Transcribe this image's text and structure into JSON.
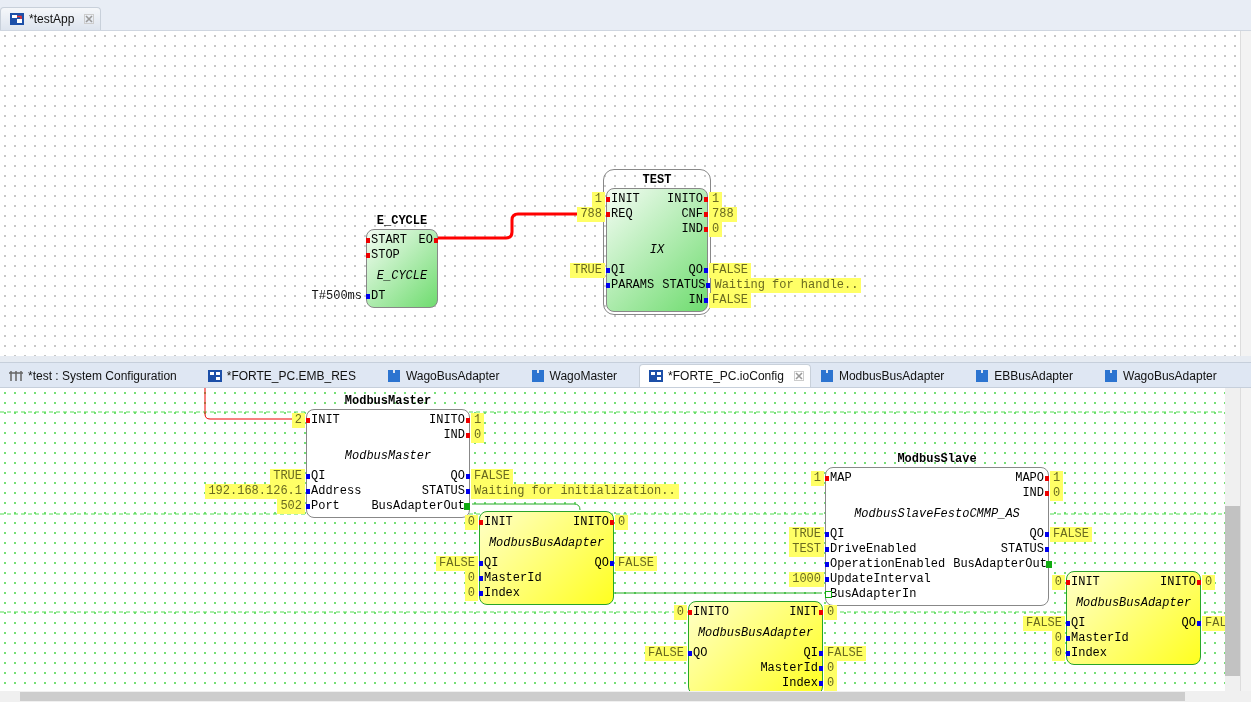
{
  "editor_tabs": [
    {
      "label": "*testApp",
      "kind": "application",
      "selected": true
    }
  ],
  "app_diagram": {
    "blocks": [
      {
        "title": "E_CYCLE",
        "type": "E_CYCLE",
        "kind": "basic",
        "selected": false,
        "events": {
          "left": [
            {
              "name": "START",
              "kind": "event"
            },
            {
              "name": "STOP",
              "kind": "event"
            }
          ],
          "right": [
            {
              "name": "EO",
              "kind": "event"
            }
          ]
        },
        "data": {
          "left": [
            {
              "name": "DT",
              "kind": "data",
              "value": "T#500ms",
              "watched": false
            }
          ]
        }
      },
      {
        "title": "TEST",
        "type": "IX",
        "kind": "basic",
        "selected": true,
        "events": {
          "left": [
            {
              "name": "INIT",
              "kind": "event",
              "value": "1",
              "watched": true
            },
            {
              "name": "REQ",
              "kind": "event",
              "value": "788",
              "watched": true
            }
          ],
          "right": [
            {
              "name": "INITO",
              "kind": "event",
              "value": "1",
              "watched": true
            },
            {
              "name": "CNF",
              "kind": "event",
              "value": "788",
              "watched": true
            },
            {
              "name": "IND",
              "kind": "event",
              "value": "0",
              "watched": true
            }
          ]
        },
        "data": {
          "left": [
            {
              "name": "QI",
              "kind": "data",
              "value": "TRUE",
              "watched": true
            },
            {
              "name": "PARAMS",
              "kind": "data"
            }
          ],
          "right": [
            {
              "name": "QO",
              "kind": "data",
              "value": "FALSE",
              "watched": true
            },
            {
              "name": "STATUS",
              "kind": "data",
              "value": "Waiting for handle..",
              "watched": true
            },
            {
              "name": "IN",
              "kind": "data",
              "value": "FALSE",
              "watched": true
            }
          ]
        }
      }
    ]
  },
  "config_tabs": [
    {
      "label": "*test : System Configuration",
      "kind": "system",
      "selected": false
    },
    {
      "label": "*FORTE_PC.EMB_RES",
      "kind": "resource",
      "selected": false
    },
    {
      "label": "WagoBusAdapter",
      "kind": "adapter",
      "selected": false
    },
    {
      "label": "WagoMaster",
      "kind": "adapter",
      "selected": false
    },
    {
      "label": "*FORTE_PC.ioConfig",
      "kind": "resource",
      "selected": true
    },
    {
      "label": "ModbusBusAdapter",
      "kind": "adapter",
      "selected": false
    },
    {
      "label": "EBBusAdapter",
      "kind": "adapter",
      "selected": false
    },
    {
      "label": "WagoBusAdapter",
      "kind": "adapter",
      "selected": false
    }
  ],
  "config_diagram": {
    "blocks": [
      {
        "title": "ModbusMaster",
        "type": "ModbusMaster",
        "kind": "service",
        "selected": false,
        "events": {
          "left": [
            {
              "name": "INIT",
              "kind": "event",
              "value": "2",
              "watched": true
            }
          ],
          "right": [
            {
              "name": "INITO",
              "kind": "event",
              "value": "1",
              "watched": true
            },
            {
              "name": "IND",
              "kind": "event",
              "value": "0",
              "watched": true
            }
          ]
        },
        "data": {
          "left": [
            {
              "name": "QI",
              "kind": "data",
              "value": "TRUE",
              "watched": true
            },
            {
              "name": "Address",
              "kind": "data",
              "value": "192.168.126.1",
              "watched": true
            },
            {
              "name": "Port",
              "kind": "data",
              "value": "502",
              "watched": true
            }
          ],
          "right": [
            {
              "name": "QO",
              "kind": "data",
              "value": "FALSE",
              "watched": true
            },
            {
              "name": "STATUS",
              "kind": "data",
              "value": "Waiting for initialization..",
              "watched": true
            },
            {
              "name": "BusAdapterOut",
              "kind": "plug"
            }
          ]
        }
      },
      {
        "type": "ModbusBusAdapter",
        "kind": "adapter",
        "selected": false,
        "events": {
          "left": [
            {
              "name": "INIT",
              "kind": "event",
              "value": "0",
              "watched": true
            }
          ],
          "right": [
            {
              "name": "INITO",
              "kind": "event",
              "value": "0",
              "watched": true
            }
          ]
        },
        "data": {
          "left": [
            {
              "name": "QI",
              "kind": "data",
              "value": "FALSE",
              "watched": true
            },
            {
              "name": "MasterId",
              "kind": "data",
              "value": "0",
              "watched": true
            },
            {
              "name": "Index",
              "kind": "data",
              "value": "0",
              "watched": true
            }
          ],
          "right": [
            {
              "name": "QO",
              "kind": "data",
              "value": "FALSE",
              "watched": true
            }
          ]
        }
      },
      {
        "title": "ModbusSlave",
        "type": "ModbusSlaveFestoCMMP_AS",
        "kind": "service",
        "selected": false,
        "events": {
          "left": [
            {
              "name": "MAP",
              "kind": "event",
              "value": "1",
              "watched": true
            }
          ],
          "right": [
            {
              "name": "MAPO",
              "kind": "event",
              "value": "1",
              "watched": true
            },
            {
              "name": "IND",
              "kind": "event",
              "value": "0",
              "watched": true
            }
          ]
        },
        "data": {
          "left": [
            {
              "name": "QI",
              "kind": "data",
              "value": "TRUE",
              "watched": true
            },
            {
              "name": "DriveEnabled",
              "kind": "data",
              "value": "TEST",
              "watched": true
            },
            {
              "name": "OperationEnabled",
              "kind": "data"
            },
            {
              "name": "UpdateInterval",
              "kind": "data",
              "value": "1000",
              "watched": true
            },
            {
              "name": "BusAdapterIn",
              "kind": "socket"
            }
          ],
          "right": [
            {
              "name": "QO",
              "kind": "data",
              "value": "FALSE",
              "watched": true
            },
            {
              "name": "STATUS",
              "kind": "data"
            },
            {
              "name": "BusAdapterOut",
              "kind": "plug"
            }
          ]
        }
      },
      {
        "type": "ModbusBusAdapter",
        "kind": "adapter",
        "selected": false,
        "events": {
          "left": [
            {
              "name": "INITO",
              "kind": "event",
              "value": "0",
              "watched": true
            }
          ],
          "right": [
            {
              "name": "INIT",
              "kind": "event",
              "value": "0",
              "watched": true
            }
          ]
        },
        "data": {
          "left": [
            {
              "name": "QO",
              "kind": "data",
              "value": "FALSE",
              "watched": true
            }
          ],
          "right": [
            {
              "name": "QI",
              "kind": "data",
              "value": "FALSE",
              "watched": true
            },
            {
              "name": "MasterId",
              "kind": "data",
              "value": "0",
              "watched": true
            },
            {
              "name": "Index",
              "kind": "data",
              "value": "0",
              "watched": true
            }
          ]
        }
      },
      {
        "type": "ModbusBusAdapter",
        "kind": "adapter",
        "selected": false,
        "events": {
          "left": [
            {
              "name": "INIT",
              "kind": "event",
              "value": "0",
              "watched": true
            }
          ],
          "right": [
            {
              "name": "INITO",
              "kind": "event",
              "value": "0",
              "watched": true
            }
          ]
        },
        "data": {
          "left": [
            {
              "name": "QI",
              "kind": "data",
              "value": "FALSE",
              "watched": true
            },
            {
              "name": "MasterId",
              "kind": "data",
              "value": "0",
              "watched": true
            },
            {
              "name": "Index",
              "kind": "data",
              "value": "0",
              "watched": true
            }
          ],
          "right": [
            {
              "name": "QO",
              "kind": "data",
              "value": "FAL",
              "watched": true
            }
          ]
        }
      }
    ]
  }
}
